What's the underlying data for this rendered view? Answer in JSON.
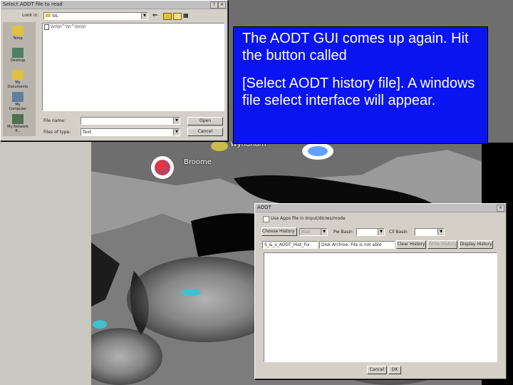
{
  "background": {
    "place_labels": [
      "Broome",
      "Wyndham"
    ]
  },
  "file_dialog": {
    "title": "Select AODT file to read",
    "look_in_label": "Look in:",
    "look_in_value": "SIL",
    "file_entry": "\\\\n\\\\n^\\\\n^\\\\n\\\\n",
    "places": [
      "Temp",
      "Desktop",
      "My Documents",
      "My Computer",
      "My Network P..."
    ],
    "filename_label": "File name:",
    "filename_value": "",
    "filetype_label": "Files of type:",
    "filetype_value": "Text",
    "open_label": "Open",
    "cancel_label": "Cancel"
  },
  "aodt_window": {
    "title": "AODT",
    "checkbox_label": "Use Apps file in IInput/dir/ws/mode",
    "history_button_label": "Choose History File",
    "bias_label": "Bias",
    "pw_label": "Pw Basin",
    "cli_label": "Cli Basin",
    "history_path": "S_&_s_AODT_Hist_Fix",
    "history_status": "Disk Archive: File is not able",
    "clear_history_label": "Clear History",
    "write_history_label": "Write History",
    "display_history_label": "Display History",
    "cancel_label": "Cancel",
    "ok_label": "OK"
  },
  "note": {
    "line1": "The AODT GUI comes up again. Hit the button called",
    "line2": "[Select AODT history file]. A windows file select interface will appear."
  },
  "colors": {
    "note_background": "#0a14f0",
    "note_text": "#ffffff",
    "window_face": "#d4d0c8",
    "desktop": "#c8c8c0"
  }
}
